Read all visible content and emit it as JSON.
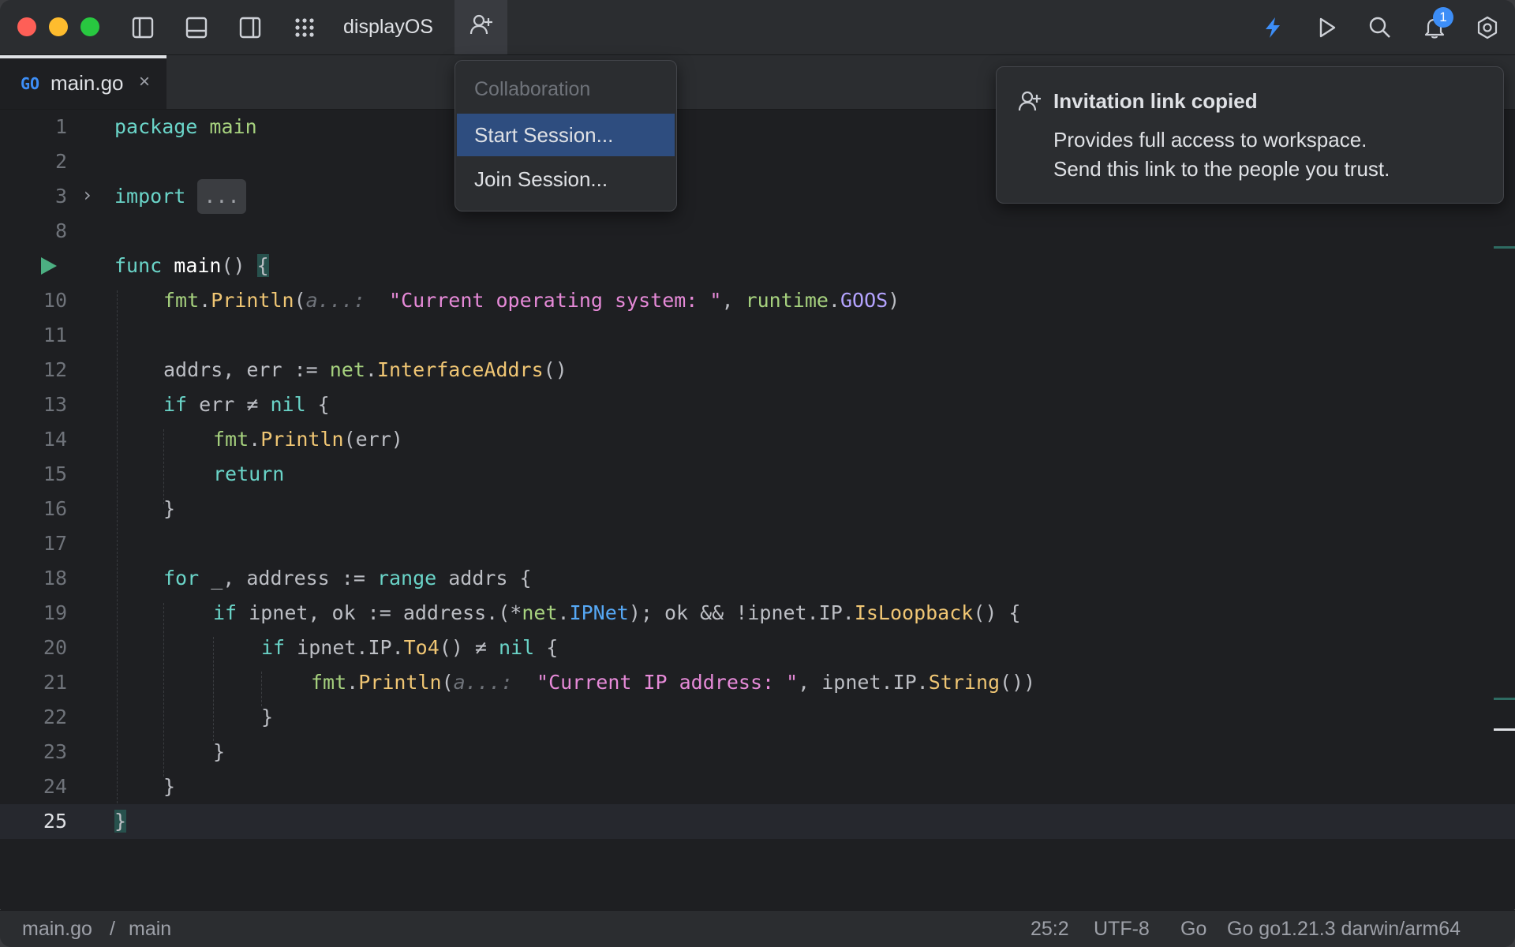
{
  "titlebar": {
    "project_name": "displayOS",
    "notification_count": "1",
    "icons": [
      "sidebar-left-icon",
      "panel-bottom-icon",
      "sidebar-right-icon",
      "apps-grid-icon",
      "add-user-icon",
      "lightning-icon",
      "run-icon",
      "search-icon",
      "bell-icon",
      "settings-icon"
    ]
  },
  "tab": {
    "lang_badge": "GO",
    "label": "main.go",
    "close": "×"
  },
  "editor": {
    "line_numbers": [
      "1",
      "2",
      "3",
      "8",
      "",
      "10",
      "11",
      "12",
      "13",
      "14",
      "15",
      "16",
      "17",
      "18",
      "19",
      "20",
      "21",
      "22",
      "23",
      "24",
      "25"
    ],
    "folded_placeholder": "...",
    "hint_param": "a...:"
  },
  "collab_menu": {
    "header": "Collaboration",
    "items": [
      "Start Session...",
      "Join Session..."
    ]
  },
  "notification": {
    "title": "Invitation link copied",
    "body_line1": "Provides full access to workspace.",
    "body_line2": "Send this link to the people you trust."
  },
  "statusbar": {
    "breadcrumb_file": "main.go",
    "breadcrumb_sep": "/",
    "breadcrumb_func": "main",
    "position": "25:2",
    "encoding": "UTF-8",
    "language": "Go",
    "sdk": "Go go1.21.3 darwin/arm64"
  },
  "colors": {
    "accent": "#3d8ef7",
    "menu_selected": "#2e4d7f",
    "run_green": "#4caf82"
  }
}
